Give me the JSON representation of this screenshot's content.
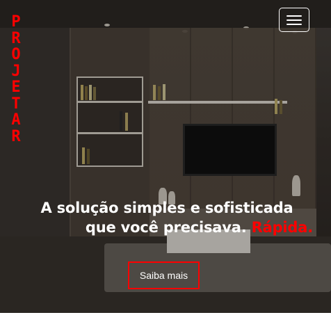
{
  "brand": {
    "logo_letters": [
      "P",
      "R",
      "O",
      "J",
      "E",
      "T",
      "A",
      "R"
    ],
    "color": "#ff0000"
  },
  "nav": {
    "menu_icon": "hamburger-icon"
  },
  "hero": {
    "headline_line1": "A solução simples e sofisticada",
    "headline_line2": "que você precisava.",
    "headline_highlight": "Rápida.",
    "highlight_color": "#ff0000",
    "cta_label": "Saiba mais",
    "cta_border_color": "#ff0000"
  }
}
